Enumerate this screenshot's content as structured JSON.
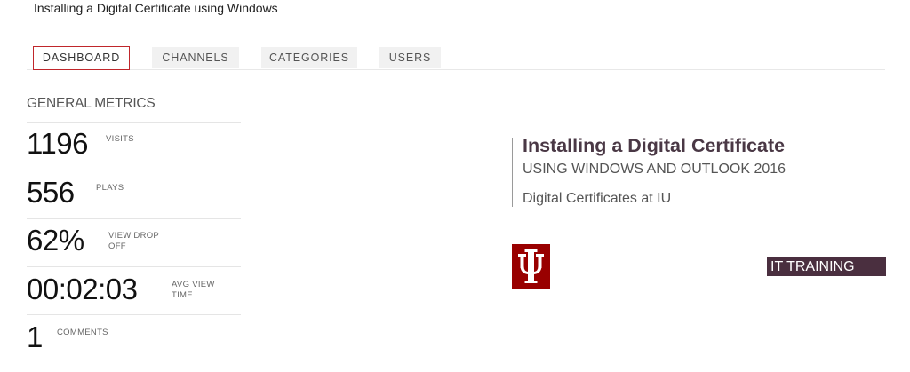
{
  "page": {
    "title": "Installing a Digital Certificate using Windows"
  },
  "tabs": [
    {
      "label": "DASHBOARD",
      "active": true
    },
    {
      "label": "CHANNELS",
      "active": false
    },
    {
      "label": "CATEGORIES",
      "active": false
    },
    {
      "label": "USERS",
      "active": false
    }
  ],
  "metrics": {
    "heading": "GENERAL METRICS",
    "items": [
      {
        "value": "1196",
        "label": "VISITS"
      },
      {
        "value": "556",
        "label": "PLAYS"
      },
      {
        "value": "62%",
        "label": "VIEW DROP OFF"
      },
      {
        "value": "00:02:03",
        "label": "AVG VIEW TIME"
      },
      {
        "value": "1",
        "label": "COMMENTS"
      }
    ]
  },
  "thumbnail": {
    "title": "Installing a Digital Certificate",
    "subtitle": "USING WINDOWS AND OUTLOOK 2016",
    "series": "Digital Certificates at IU",
    "badge": "IT TRAINING",
    "logo_icon": "iu-trident-logo",
    "colors": {
      "title": "#4a3845",
      "logo": "#990000",
      "badge": "#4a2f3f"
    }
  },
  "colors": {
    "active_tab_border": "#c0262b",
    "tab_background": "#f1f1f1"
  }
}
